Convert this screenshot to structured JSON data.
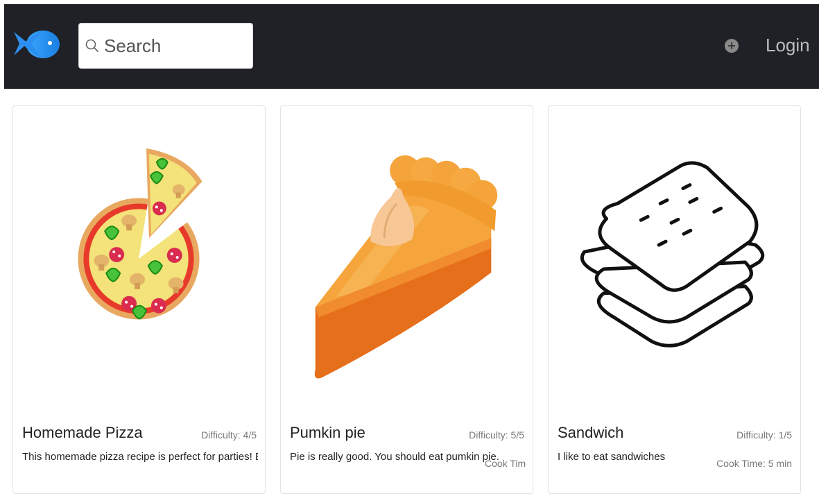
{
  "navbar": {
    "logo_icon": "fish-icon",
    "search": {
      "placeholder": "Search",
      "value": "",
      "icon": "search-icon"
    },
    "add_icon": "plus-circle-icon",
    "login_label": "Login"
  },
  "recipes": [
    {
      "title": "Homemade Pizza",
      "difficulty": "Difficulty: 4/5",
      "description": "This homemade pizza recipe is perfect for parties! Ever",
      "image_icon": "pizza-icon"
    },
    {
      "title": "Pumkin pie",
      "difficulty": "Difficulty: 5/5",
      "description": "Pie is really good. You should eat pumkin pie.",
      "cook_time": "Cook Time",
      "image_icon": "pie-slice-icon"
    },
    {
      "title": "Sandwich",
      "difficulty": "Difficulty: 1/5",
      "description": "I like to eat sandwiches",
      "cook_time": "Cook Time: 5 min",
      "image_icon": "sandwich-icon"
    }
  ],
  "colors": {
    "navbar_bg": "#1f2126",
    "logo_blue": "#2196f3",
    "pizza_crust": "#e8a85f",
    "pie_orange": "#ef8a2c"
  }
}
